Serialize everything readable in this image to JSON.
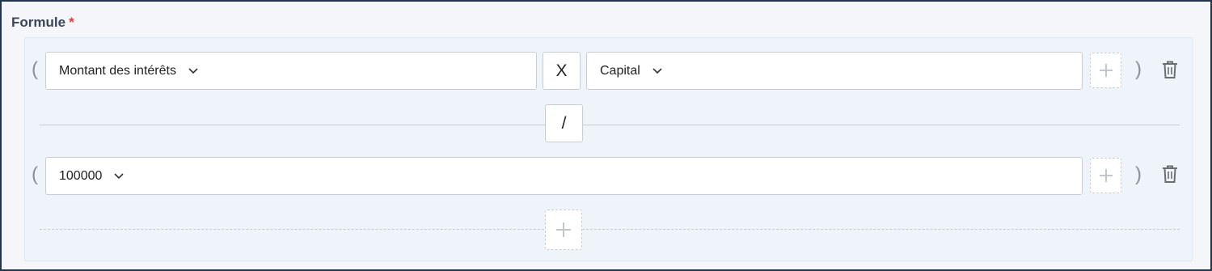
{
  "field": {
    "label": "Formule",
    "required_mark": "*"
  },
  "rows": [
    {
      "open_paren": "(",
      "close_paren": ")",
      "left_select": "Montant des intérêts",
      "operator": "X",
      "right_select": "Capital"
    },
    {
      "open_paren": "(",
      "close_paren": ")",
      "left_select": "100000"
    }
  ],
  "divider_operator": "/",
  "icons": {
    "chevron": "chevron-down-icon",
    "add": "plus-icon",
    "delete": "trash-icon"
  },
  "colors": {
    "frame_border": "#1e3553",
    "required": "#e0403a",
    "panel_bg": "#eff4fb"
  }
}
